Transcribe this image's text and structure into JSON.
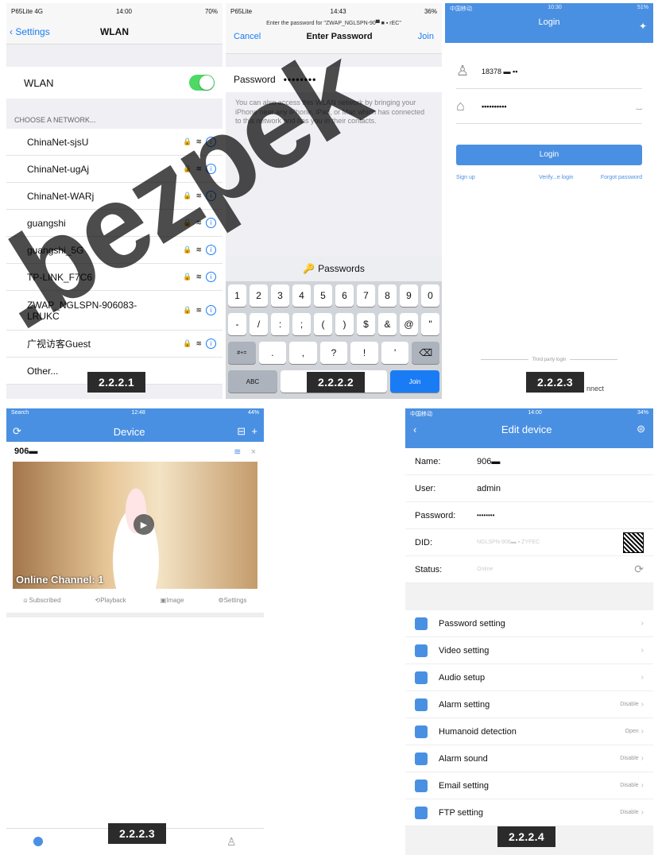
{
  "p1": {
    "carrier": "P65Lite 4G",
    "time": "14:00",
    "battery": "70%",
    "back": "Settings",
    "title": "WLAN",
    "wlan_label": "WLAN",
    "choose": "CHOOSE A NETWORK...",
    "networks": [
      "ChinaNet-sjsU",
      "ChinaNet-ugAj",
      "ChinaNet-WARj",
      "guangshi",
      "guangshi_5G",
      "TP-LINK_F7C6",
      "ZWAP_NGLSPN-906083-LRUKC",
      "广视访客Guest"
    ],
    "other": "Other...",
    "caption": "2.2.2.1"
  },
  "p2": {
    "carrier": "P65Lite",
    "time": "14:43",
    "battery": "36%",
    "prompt": "Enter the password for \"ZWAP_NGLSPN-90▀ ■ ▪ rEC\"",
    "cancel": "Cancel",
    "title": "Enter Password",
    "join": "Join",
    "pw_label": "Password",
    "pw_value": "••••••••",
    "help": "You can also access this WLAN network by bringing your iPhone near any iPhone, iPad, or Mac which has connected to this network and has you in their contacts.",
    "kb_top": "Passwords",
    "row1": [
      "1",
      "2",
      "3",
      "4",
      "5",
      "6",
      "7",
      "8",
      "9",
      "0"
    ],
    "row2": [
      "-",
      "/",
      ":",
      ";",
      "(",
      ")",
      "$",
      "&",
      "@",
      "\""
    ],
    "row3": [
      ".",
      ",",
      "?",
      "!",
      "'"
    ],
    "sym": "#+=",
    "abc": "ABC",
    "kjoin": "Join",
    "caption": "2.2.2.2"
  },
  "p3": {
    "carrier": "中国移动",
    "time": "10:30",
    "battery": "51%",
    "title": "Login",
    "user": "18378 ▬ ▪▪",
    "pass": "••••••••••",
    "login": "Login",
    "signup": "Sign up",
    "verify": "Verify...e login",
    "forgot": "Forgot password",
    "third": "Third party login",
    "connect": "nnect",
    "caption": "2.2.2.3"
  },
  "p4": {
    "carrier": "Search",
    "time": "12:48",
    "battery": "44%",
    "title": "Device",
    "device_name": "906▬",
    "channel": "Online Channel: 1",
    "tabs": [
      "Subscribed",
      "Playback",
      "Image",
      "Settings"
    ],
    "caption": "2.2.2.3"
  },
  "p5": {
    "carrier": "中国移动",
    "time": "14:00",
    "battery": "34%",
    "title": "Edit device",
    "fields": [
      {
        "k": "Name:",
        "v": "906▬"
      },
      {
        "k": "User:",
        "v": "admin"
      },
      {
        "k": "Password:",
        "v": "••••••••"
      },
      {
        "k": "DID:",
        "v": "NGLSPN-906▬ ▪ ZYFEC"
      },
      {
        "k": "Status:",
        "v": "Online"
      }
    ],
    "menu": [
      {
        "l": "Password setting",
        "v": ""
      },
      {
        "l": "Video setting",
        "v": ""
      },
      {
        "l": "Audio setup",
        "v": ""
      },
      {
        "l": "Alarm setting",
        "v": "Disable"
      },
      {
        "l": "Humanoid detection",
        "v": "Open"
      },
      {
        "l": "Alarm sound",
        "v": "Disable"
      },
      {
        "l": "Email setting",
        "v": "Disable"
      },
      {
        "l": "FTP setting",
        "v": "Disable"
      }
    ],
    "caption": "2.2.2.4"
  }
}
